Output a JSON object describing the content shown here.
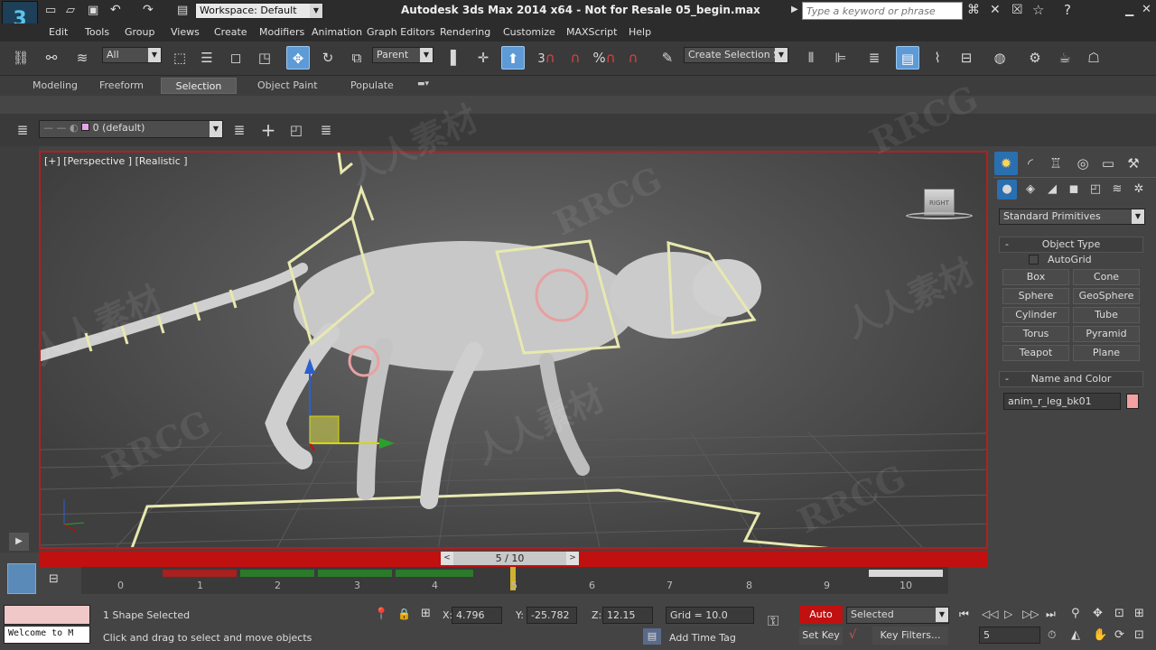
{
  "app": {
    "title": "Autodesk 3ds Max  2014 x64  - Not for Resale   05_begin.max",
    "workspace": "Workspace: Default",
    "search_placeholder": "Type a keyword or phrase"
  },
  "menu": [
    "Edit",
    "Tools",
    "Group",
    "Views",
    "Create",
    "Modifiers",
    "Animation",
    "Graph Editors",
    "Rendering",
    "Customize",
    "MAXScript",
    "Help"
  ],
  "toolbar": {
    "filter": "All",
    "ref_coord": "Parent",
    "snap_labels": [
      "3",
      "%"
    ],
    "named_selection_placeholder": "Create Selection Se"
  },
  "ribbon_tabs": [
    "Modeling",
    "Freeform",
    "Selection",
    "Object Paint",
    "Populate"
  ],
  "ribbon_active": "Selection",
  "layer": {
    "current": "0 (default)"
  },
  "viewport": {
    "label": "[+] [Perspective ] [Realistic ]",
    "viewcube_label": "RIGHT"
  },
  "command_panel": {
    "category": "Standard Primitives",
    "object_type_title": "Object Type",
    "autogrid_label": "AutoGrid",
    "primitives": [
      "Box",
      "Cone",
      "Sphere",
      "GeoSphere",
      "Cylinder",
      "Tube",
      "Torus",
      "Pyramid",
      "Teapot",
      "Plane"
    ],
    "name_color_title": "Name and Color",
    "object_name": "anim_r_leg_bk01",
    "object_color": "#f2a0a0"
  },
  "timeline": {
    "frame_display": "5 / 10",
    "current_frame": 5,
    "total_frames": 10,
    "ticks": [
      "0",
      "1",
      "2",
      "3",
      "4",
      "5",
      "6",
      "7",
      "8",
      "9",
      "10"
    ]
  },
  "status": {
    "maxscript_listener": "Welcome to M",
    "selection_info": "1 Shape Selected",
    "prompt": "Click and drag to select and move objects",
    "x_label": "X:",
    "x": "4.796",
    "y_label": "Y:",
    "y": "-25.782",
    "z_label": "Z:",
    "z": "12.15",
    "grid": "Grid = 10.0",
    "auto_key": "Auto Key",
    "set_key": "Set Key",
    "key_mode": "Selected",
    "key_filters": "Key Filters...",
    "add_time_tag": "Add Time Tag",
    "frame_spinner": "5"
  },
  "colors": {
    "accent_red": "#c01010",
    "ui_dark": "#2c2c2c",
    "gizmo_yellow": "#e8e8b0",
    "selection_blue": "#2a6fb0"
  },
  "watermarks": [
    "RRCG",
    "人人素材",
    "RRCG",
    "人人素材",
    "RRCG",
    "人人素材",
    "RRCG",
    "人人素材"
  ]
}
